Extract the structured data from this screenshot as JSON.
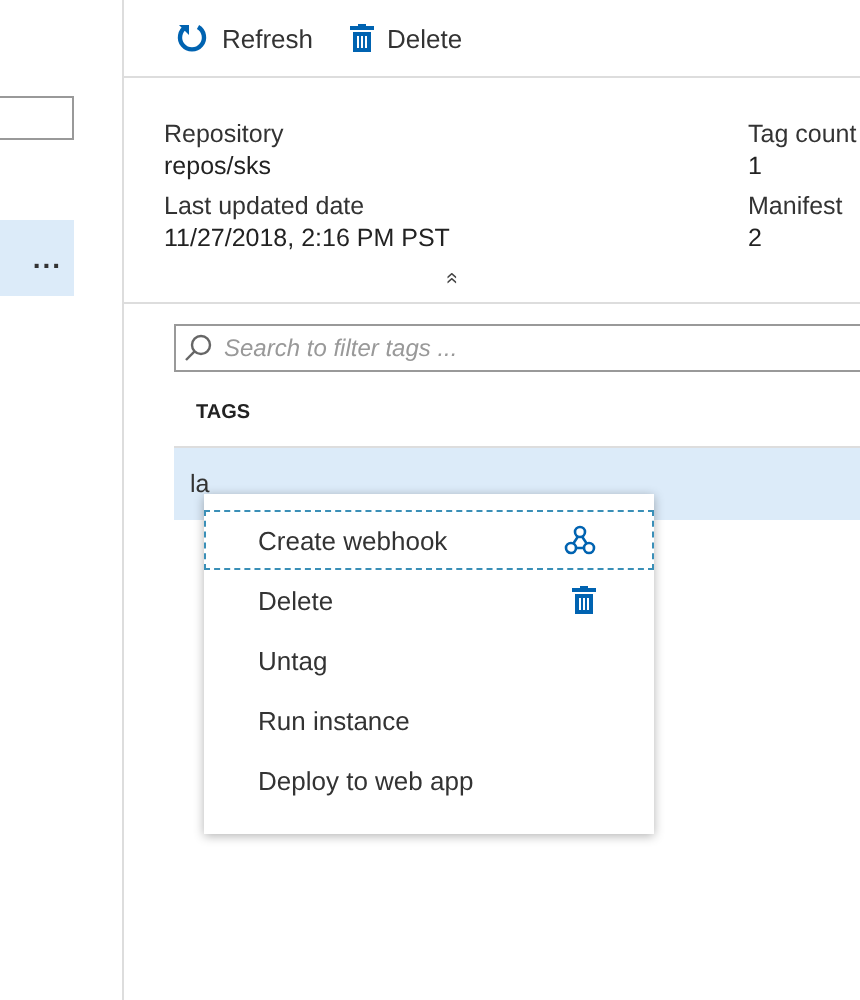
{
  "left_panel": {
    "rows": [
      {
        "more": "...",
        "selected": true
      }
    ]
  },
  "toolbar": [
    {
      "label": "Refresh",
      "kind": "refresh"
    },
    {
      "label": "Delete",
      "kind": "trash"
    }
  ],
  "essentials": {
    "left": [
      {
        "label": "Repository",
        "value": "repos/sks"
      },
      {
        "label": "Last updated date",
        "value": "11/27/2018, 2:16 PM PST"
      }
    ],
    "right": [
      {
        "label": "Tag count",
        "value": "1"
      },
      {
        "label": "Manifest",
        "value": "2"
      }
    ],
    "collapse": "«"
  },
  "tags": {
    "search": {
      "placeholder": "Search to filter tags ..."
    },
    "column": "TAGS",
    "rows": [
      {
        "name": "la",
        "selected": true
      }
    ]
  },
  "context_menu": {
    "items": [
      {
        "label": "Create webhook",
        "kind": "webhook",
        "focused": true
      },
      {
        "label": "Delete",
        "kind": "trash",
        "focused": false
      },
      {
        "label": "Untag",
        "kind": "plain",
        "focused": false
      },
      {
        "label": "Run instance",
        "kind": "plain",
        "focused": false
      },
      {
        "label": "Deploy to web app",
        "kind": "plain",
        "focused": false
      }
    ]
  }
}
